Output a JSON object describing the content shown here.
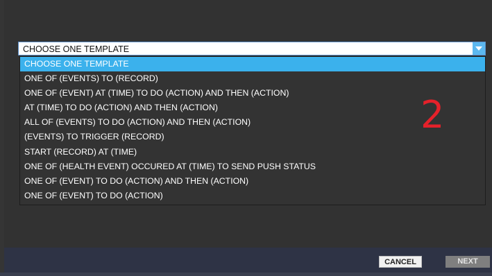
{
  "template_select": {
    "value": "CHOOSE ONE TEMPLATE",
    "options": [
      "CHOOSE ONE TEMPLATE",
      "ONE OF (EVENTS) TO (RECORD)",
      "ONE OF (EVENT) AT (TIME) TO DO (ACTION) AND THEN (ACTION)",
      "AT (TIME) TO DO (ACTION) AND THEN (ACTION)",
      "ALL OF (EVENTS) TO DO (ACTION) AND THEN (ACTION)",
      "(EVENTS) TO TRIGGER (RECORD)",
      "START (RECORD) AT (TIME)",
      "ONE OF (HEALTH EVENT) OCCURED AT (TIME) TO SEND PUSH STATUS",
      "ONE OF (EVENT) TO DO (ACTION) AND THEN (ACTION)",
      "ONE OF (EVENT) TO DO (ACTION)"
    ],
    "selected_index": 0,
    "arrow_icon": "chevron-down-icon"
  },
  "annotation": {
    "marker": "2",
    "color": "#e5212a"
  },
  "footer": {
    "cancel_label": "CANCEL",
    "next_label": "NEXT"
  },
  "colors": {
    "accent": "#3bb1ec",
    "panel": "#333333",
    "footer": "#2e3345"
  }
}
